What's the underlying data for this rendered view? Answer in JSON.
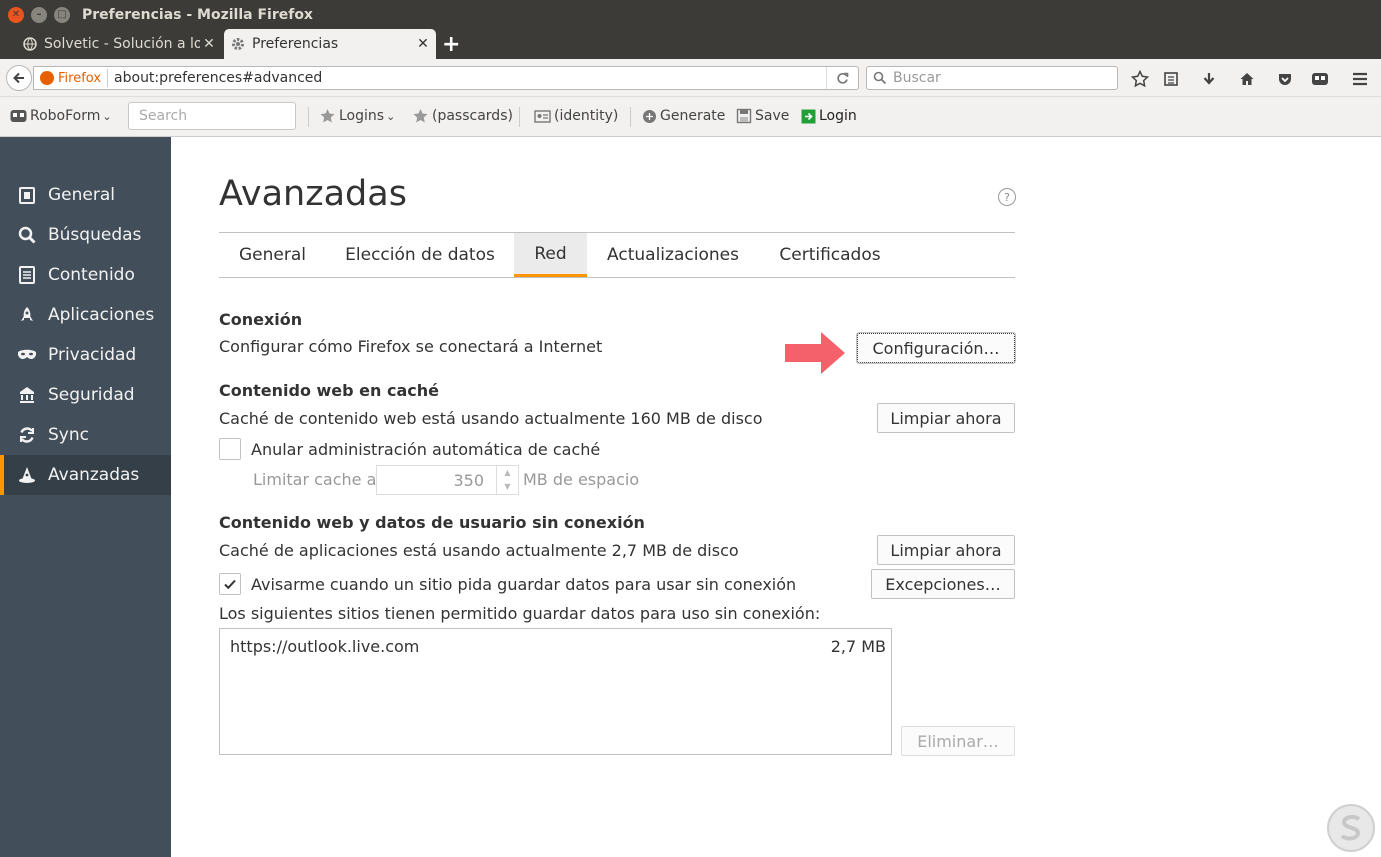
{
  "window": {
    "title": "Preferencias - Mozilla Firefox"
  },
  "tabs": [
    {
      "label": "Solvetic - Solución a los"
    },
    {
      "label": "Preferencias"
    }
  ],
  "navbar": {
    "identity_label": "Firefox",
    "url": "about:preferences#advanced",
    "search_placeholder": "Buscar"
  },
  "roboform": {
    "brand": "RoboForm",
    "search_placeholder": "Search",
    "logins": "Logins",
    "passcards": "(passcards)",
    "identity": "(identity)",
    "generate": "Generate",
    "save": "Save",
    "login": "Login"
  },
  "sidebar": {
    "items": [
      {
        "label": "General",
        "icon": "general-icon"
      },
      {
        "label": "Búsquedas",
        "icon": "search-icon"
      },
      {
        "label": "Contenido",
        "icon": "content-icon"
      },
      {
        "label": "Aplicaciones",
        "icon": "applications-icon"
      },
      {
        "label": "Privacidad",
        "icon": "privacy-mask-icon"
      },
      {
        "label": "Seguridad",
        "icon": "security-icon"
      },
      {
        "label": "Sync",
        "icon": "sync-icon"
      },
      {
        "label": "Avanzadas",
        "icon": "advanced-wizard-icon",
        "active": true
      }
    ]
  },
  "main": {
    "title": "Avanzadas",
    "help": "?",
    "tabs": [
      {
        "label": "General"
      },
      {
        "label": "Elección de datos"
      },
      {
        "label": "Red",
        "selected": true
      },
      {
        "label": "Actualizaciones"
      },
      {
        "label": "Certificados"
      }
    ],
    "connection": {
      "heading": "Conexión",
      "description": "Configurar cómo Firefox se conectará a Internet",
      "button": "Configuración…"
    },
    "cache": {
      "heading": "Contenido web en caché",
      "description": "Caché de contenido web está usando actualmente 160 MB de disco",
      "button": "Limpiar ahora",
      "override_label": "Anular administración automática de caché",
      "override_checked": false,
      "limit_label": "Limitar cache a",
      "limit_value": "350",
      "limit_unit": "MB de espacio"
    },
    "offline": {
      "heading": "Contenido web y datos de usuario sin conexión",
      "description": "Caché de aplicaciones está usando actualmente 2,7 MB de disco",
      "clear_button": "Limpiar ahora",
      "notify_label": "Avisarme cuando un sitio pida guardar datos para usar sin conexión",
      "notify_checked": true,
      "exceptions_button": "Excepciones…",
      "list_label": "Los siguientes sitios tienen permitido guardar datos para uso sin conexión:",
      "sites": [
        {
          "url": "https://outlook.live.com",
          "size": "2,7 MB"
        }
      ],
      "remove_button": "Eliminar…"
    }
  },
  "colors": {
    "accent": "#ff9500",
    "sidebar_bg": "#424f5a",
    "arrow": "#f4616a"
  }
}
